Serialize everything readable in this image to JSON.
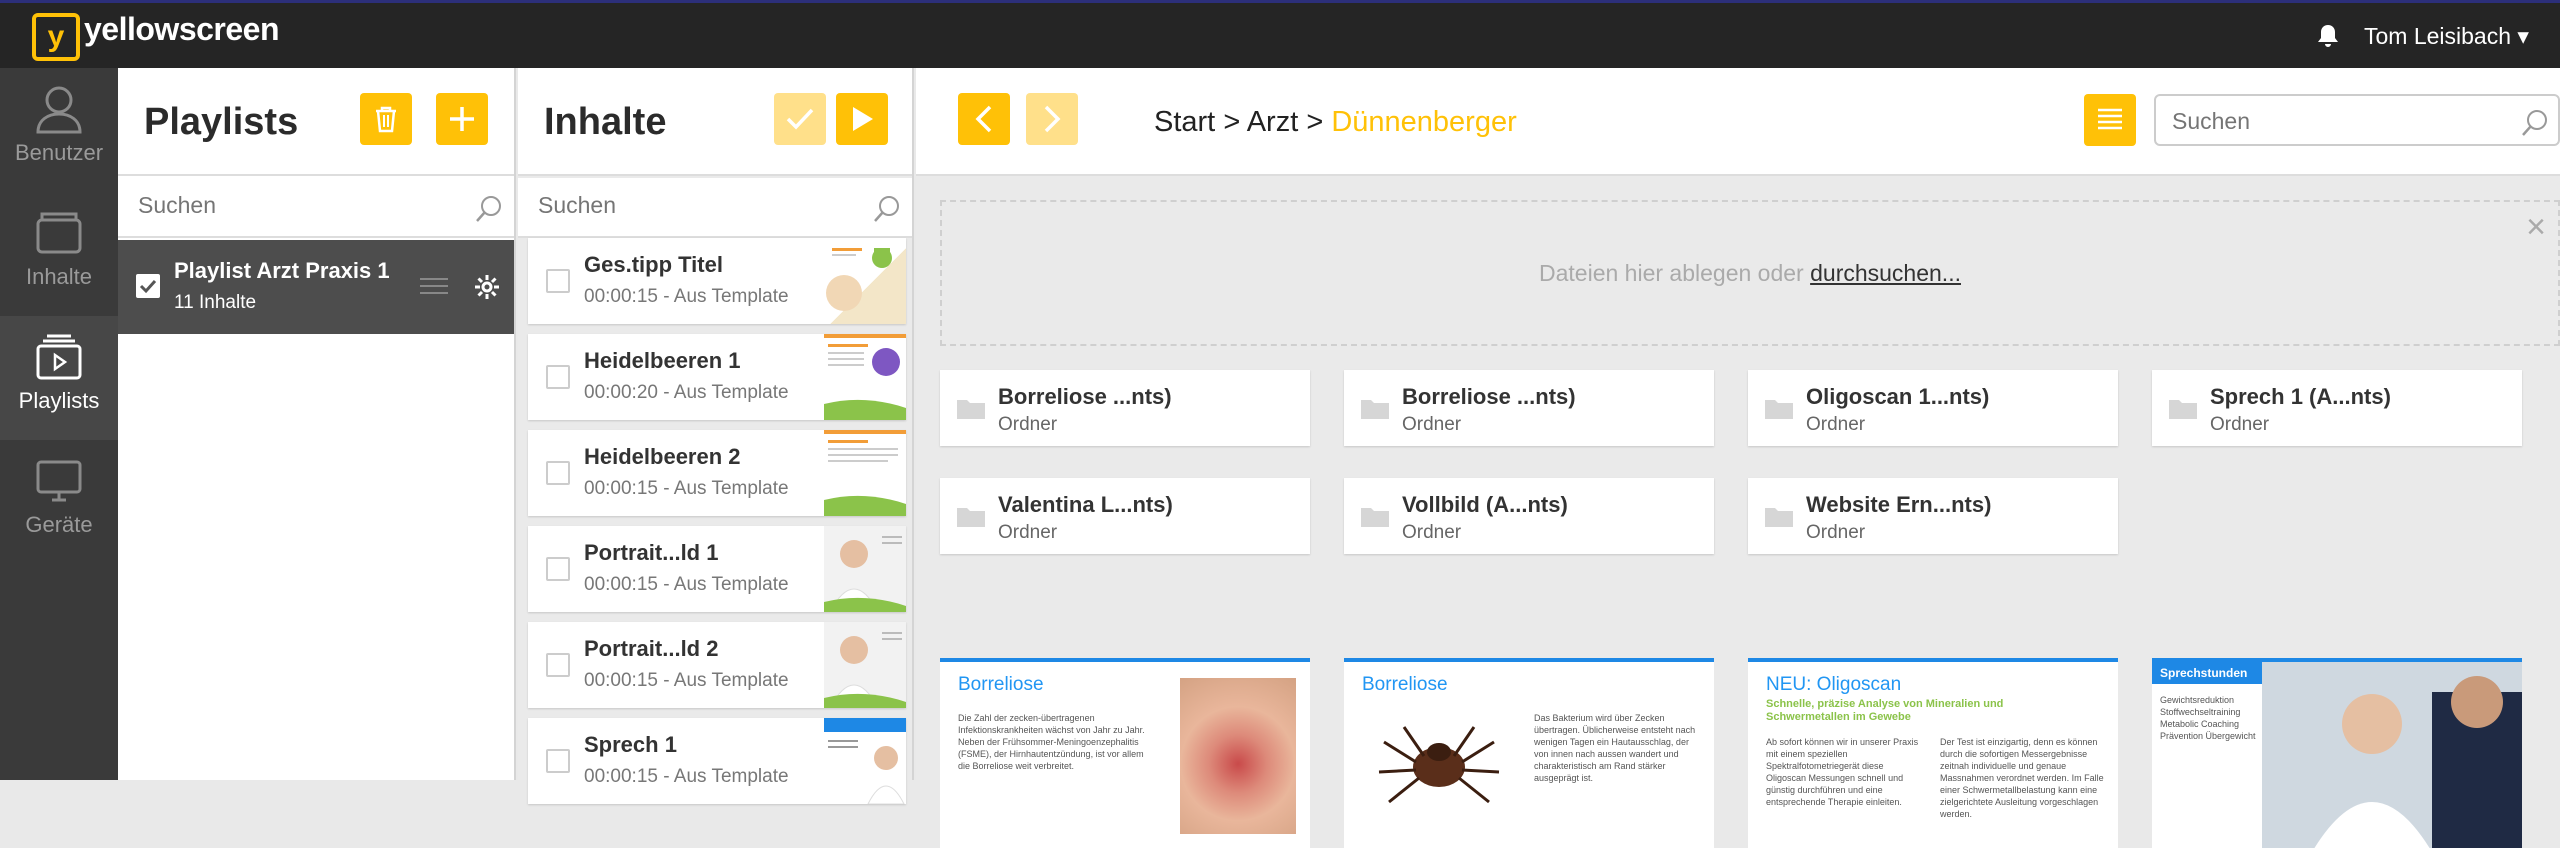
{
  "app": {
    "brand": "yellowscreen",
    "logo_letter": "y",
    "user_name": "Tom Leisibach ▾",
    "accent": "#ffc107"
  },
  "rail": [
    {
      "label": "Benutzer",
      "icon": "user-icon"
    },
    {
      "label": "Inhalte",
      "icon": "folder-icon"
    },
    {
      "label": "Playlists",
      "icon": "playlists-icon"
    },
    {
      "label": "Geräte",
      "icon": "monitor-icon"
    }
  ],
  "playlists": {
    "title": "Playlists",
    "search_placeholder": "Suchen",
    "items": [
      {
        "name": "Playlist Arzt Praxis 1",
        "count": "11 Inhalte"
      }
    ]
  },
  "inhalte": {
    "title": "Inhalte",
    "search_placeholder": "Suchen",
    "items": [
      {
        "title": "Ges.tipp Titel",
        "sub": "00:00:15 - Aus Template"
      },
      {
        "title": "Heidelbeeren 1",
        "sub": "00:00:20 - Aus Template"
      },
      {
        "title": "Heidelbeeren 2",
        "sub": "00:00:15 - Aus Template"
      },
      {
        "title": "Portrait...ld 1",
        "sub": "00:00:15 - Aus Template"
      },
      {
        "title": "Portrait...ld 2",
        "sub": "00:00:15 - Aus Template"
      },
      {
        "title": "Sprech 1",
        "sub": "00:00:15 - Aus Template"
      }
    ]
  },
  "main": {
    "breadcrumb": {
      "start": "Start",
      "sep": ">",
      "mid": "Arzt",
      "current": "Dünnenberger"
    },
    "search_placeholder": "Suchen",
    "drop_text": "Dateien hier ablegen oder ",
    "drop_link": "durchsuchen...",
    "close": "×",
    "folders": [
      {
        "name": "Borreliose ...nts)",
        "type": "Ordner"
      },
      {
        "name": "Borreliose ...nts)",
        "type": "Ordner"
      },
      {
        "name": "Oligoscan 1...nts)",
        "type": "Ordner"
      },
      {
        "name": "Sprech 1 (A...nts)",
        "type": "Ordner"
      },
      {
        "name": "Valentina L...nts)",
        "type": "Ordner"
      },
      {
        "name": "Vollbild (A...nts)",
        "type": "Ordner"
      },
      {
        "name": "Website Ern...nts)",
        "type": "Ordner"
      }
    ],
    "cards": [
      {
        "title": "Borreliose",
        "text": "Die Zahl der zecken-übertragenen Infektionskrankheiten wächst von Jahr zu Jahr. Neben der Frühsommer-Meningoenzephalitis (FSME), der Hirnhautentzündung, ist vor allem die Borreliose weit verbreitet."
      },
      {
        "title": "Borreliose",
        "text": "Das Bakterium wird über Zecken übertragen. Üblicherweise entsteht nach wenigen Tagen ein Hautausschlag, der von innen nach aussen wandert und charakteristisch am Rand stärker ausgeprägt ist."
      },
      {
        "title": "NEU: Oligoscan",
        "subtitle": "Schnelle, präzise Analyse von Mineralien und Schwermetallen im Gewebe",
        "text": "Ab sofort können wir in unserer Praxis mit einem speziellen Spektralfotometriegerät diese Oligoscan Messungen schnell und günstig durchführen und eine entsprechende Therapie einleiten.",
        "text2": "Der Test ist einzigartig, denn es können durch die sofortigen Messergebnisse zeitnah individuelle und genaue Massnahmen verordnet werden. Im Falle einer Schwermetallbelastung kann eine zielgerichtete Ausleitung vorgeschlagen werden."
      },
      {
        "title": "Sprechstunden",
        "text": "Gewichtsreduktion Stoffwechseltraining Metabolic Coaching Prävention Übergewicht"
      }
    ]
  }
}
